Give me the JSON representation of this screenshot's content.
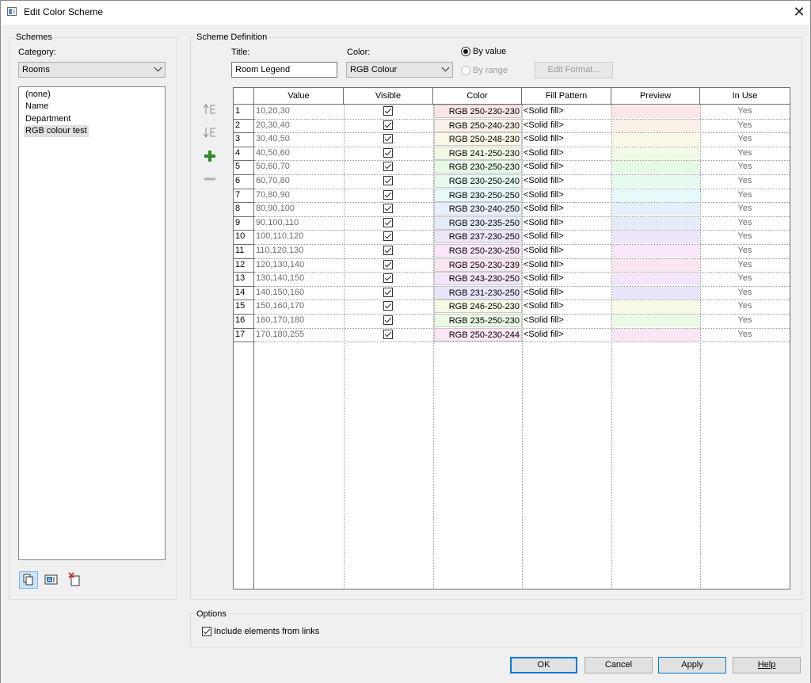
{
  "window": {
    "title": "Edit Color Scheme",
    "close_glyph": "✕"
  },
  "schemes": {
    "group_label": "Schemes",
    "category_label": "Category:",
    "category_value": "Rooms",
    "items": [
      "(none)",
      "Name",
      "Department",
      "RGB colour test"
    ],
    "selected_index": 3,
    "icons": [
      "duplicate-icon",
      "rename-icon",
      "delete-icon"
    ]
  },
  "definition": {
    "group_label": "Scheme Definition",
    "title_label": "Title:",
    "title_value": "Room Legend",
    "color_label": "Color:",
    "color_value": "RGB Colour",
    "by_value_label": "By value",
    "by_range_label": "By range",
    "edit_format_label": "Edit Format..."
  },
  "side_icons": [
    "move-up-icon",
    "move-down-icon",
    "add-icon",
    "remove-icon"
  ],
  "table": {
    "headers": [
      "Value",
      "Visible",
      "Color",
      "Fill Pattern",
      "Preview",
      "In Use"
    ],
    "rows": [
      {
        "n": "1",
        "value": "10,20,30",
        "color": "RGB 250-230-230",
        "hex": "#fae6e6",
        "fill": "<Solid fill>",
        "in_use": "Yes"
      },
      {
        "n": "2",
        "value": "20,30,40",
        "color": "RGB 250-240-230",
        "hex": "#faf0e6",
        "fill": "<Solid fill>",
        "in_use": "Yes"
      },
      {
        "n": "3",
        "value": "30,40,50",
        "color": "RGB 250-248-230",
        "hex": "#faf8e6",
        "fill": "<Solid fill>",
        "in_use": "Yes"
      },
      {
        "n": "4",
        "value": "40,50,60",
        "color": "RGB 241-250-230",
        "hex": "#f1fae6",
        "fill": "<Solid fill>",
        "in_use": "Yes"
      },
      {
        "n": "5",
        "value": "50,60,70",
        "color": "RGB 230-250-230",
        "hex": "#e6fae6",
        "fill": "<Solid fill>",
        "in_use": "Yes"
      },
      {
        "n": "6",
        "value": "60,70,80",
        "color": "RGB 230-250-240",
        "hex": "#e6faf0",
        "fill": "<Solid fill>",
        "in_use": "Yes"
      },
      {
        "n": "7",
        "value": "70,80,90",
        "color": "RGB 230-250-250",
        "hex": "#e6fafa",
        "fill": "<Solid fill>",
        "in_use": "Yes"
      },
      {
        "n": "8",
        "value": "80,90,100",
        "color": "RGB 230-240-250",
        "hex": "#e6f0fa",
        "fill": "<Solid fill>",
        "in_use": "Yes"
      },
      {
        "n": "9",
        "value": "90,100,110",
        "color": "RGB 230-235-250",
        "hex": "#e6ebfa",
        "fill": "<Solid fill>",
        "in_use": "Yes"
      },
      {
        "n": "10",
        "value": "100,110,120",
        "color": "RGB 237-230-250",
        "hex": "#ede6fa",
        "fill": "<Solid fill>",
        "in_use": "Yes"
      },
      {
        "n": "11",
        "value": "110,120,130",
        "color": "RGB 250-230-250",
        "hex": "#fae6fa",
        "fill": "<Solid fill>",
        "in_use": "Yes"
      },
      {
        "n": "12",
        "value": "120,130,140",
        "color": "RGB 250-230-239",
        "hex": "#fae6ef",
        "fill": "<Solid fill>",
        "in_use": "Yes"
      },
      {
        "n": "13",
        "value": "130,140,150",
        "color": "RGB 243-230-250",
        "hex": "#f3e6fa",
        "fill": "<Solid fill>",
        "in_use": "Yes"
      },
      {
        "n": "14",
        "value": "140,150,160",
        "color": "RGB 231-230-250",
        "hex": "#e7e6fa",
        "fill": "<Solid fill>",
        "in_use": "Yes"
      },
      {
        "n": "15",
        "value": "150,160,170",
        "color": "RGB 246-250-230",
        "hex": "#f6fae6",
        "fill": "<Solid fill>",
        "in_use": "Yes"
      },
      {
        "n": "16",
        "value": "160,170,180",
        "color": "RGB 235-250-230",
        "hex": "#ebfae6",
        "fill": "<Solid fill>",
        "in_use": "Yes"
      },
      {
        "n": "17",
        "value": "170,180,255",
        "color": "RGB 250-230-244",
        "hex": "#fae6f4",
        "fill": "<Solid fill>",
        "in_use": "Yes"
      }
    ]
  },
  "options": {
    "group_label": "Options",
    "include_links_label": "Include elements from links"
  },
  "buttons": {
    "ok": "OK",
    "cancel": "Cancel",
    "apply": "Apply",
    "help": "Help"
  },
  "colors": {
    "accent": "#0078d7",
    "add_icon": "#2e8b2e"
  }
}
